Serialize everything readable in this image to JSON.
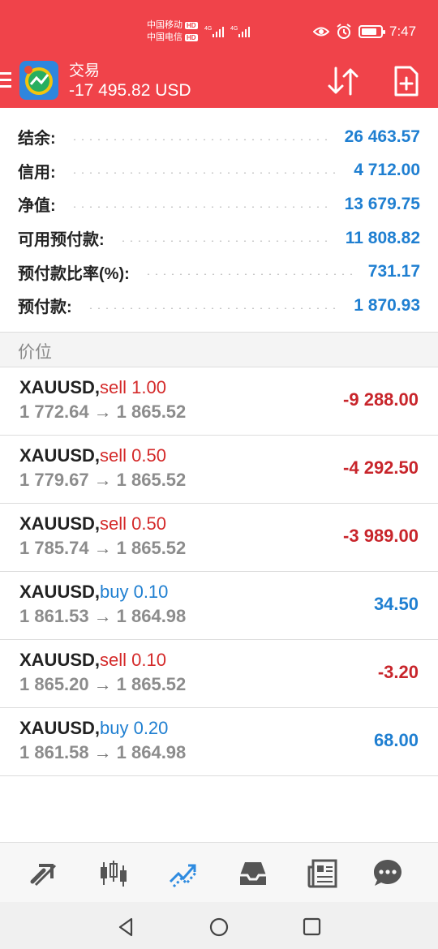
{
  "status_bar": {
    "carrier1": "中国移动",
    "carrier2": "中国电信",
    "hd_label": "HD",
    "network1": "4G",
    "network2": "4G",
    "time": "7:47",
    "icons": [
      "eye-icon",
      "alarm-icon",
      "battery-icon"
    ]
  },
  "header": {
    "title": "交易",
    "subtitle": "-17 495.82 USD",
    "background_color": "#f0434a",
    "actions": [
      "sort-icon",
      "new-order-icon"
    ]
  },
  "summary": [
    {
      "label": "结余:",
      "value": "26 463.57"
    },
    {
      "label": "信用:",
      "value": "4 712.00"
    },
    {
      "label": "净值:",
      "value": "13 679.75"
    },
    {
      "label": "可用预付款:",
      "value": "11 808.82"
    },
    {
      "label": "预付款比率(%):",
      "value": "731.17"
    },
    {
      "label": "预付款:",
      "value": "1 870.93"
    }
  ],
  "section_title": "价位",
  "positions": [
    {
      "symbol": "XAUUSD,",
      "side": "sell 1.00",
      "open": "1 772.64",
      "arrow": "→",
      "current": "1 865.52",
      "profit": "-9 288.00"
    },
    {
      "symbol": "XAUUSD,",
      "side": "sell 0.50",
      "open": "1 779.67",
      "arrow": "→",
      "current": "1 865.52",
      "profit": "-4 292.50"
    },
    {
      "symbol": "XAUUSD,",
      "side": "sell 0.50",
      "open": "1 785.74",
      "arrow": "→",
      "current": "1 865.52",
      "profit": "-3 989.00"
    },
    {
      "symbol": "XAUUSD,",
      "side": "buy 0.10",
      "open": "1 861.53",
      "arrow": "→",
      "current": "1 864.98",
      "profit": "34.50"
    },
    {
      "symbol": "XAUUSD,",
      "side": "sell 0.10",
      "open": "1 865.20",
      "arrow": "→",
      "current": "1 865.52",
      "profit": "-3.20"
    },
    {
      "symbol": "XAUUSD,",
      "side": "buy 0.20",
      "open": "1 861.58",
      "arrow": "→",
      "current": "1 864.98",
      "profit": "68.00"
    }
  ],
  "colors": {
    "accent_red": "#f0434a",
    "value_blue": "#1f7fd1",
    "loss_red": "#c8252b",
    "sell_red": "#d42a2a"
  },
  "tab_bar": {
    "items": [
      "quotes-icon",
      "chart-icon",
      "trade-icon",
      "history-icon",
      "news-icon",
      "chat-icon"
    ],
    "active": "trade-icon"
  },
  "nav_bar": {
    "items": [
      "back-icon",
      "home-icon",
      "recents-icon"
    ]
  }
}
